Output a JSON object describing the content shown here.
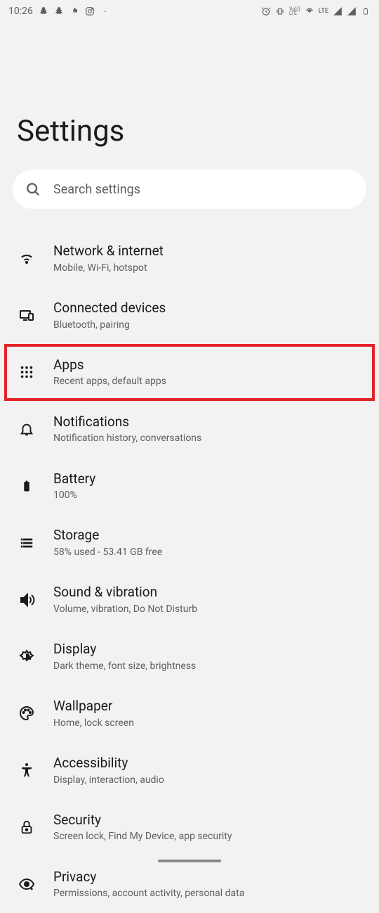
{
  "statusBar": {
    "time": "10:26",
    "lte": "LTE"
  },
  "pageTitle": "Settings",
  "search": {
    "placeholder": "Search settings"
  },
  "items": [
    {
      "title": "Network & internet",
      "subtitle": "Mobile, Wi-Fi, hotspot"
    },
    {
      "title": "Connected devices",
      "subtitle": "Bluetooth, pairing"
    },
    {
      "title": "Apps",
      "subtitle": "Recent apps, default apps"
    },
    {
      "title": "Notifications",
      "subtitle": "Notification history, conversations"
    },
    {
      "title": "Battery",
      "subtitle": "100%"
    },
    {
      "title": "Storage",
      "subtitle": "58% used - 53.41 GB free"
    },
    {
      "title": "Sound & vibration",
      "subtitle": "Volume, vibration, Do Not Disturb"
    },
    {
      "title": "Display",
      "subtitle": "Dark theme, font size, brightness"
    },
    {
      "title": "Wallpaper",
      "subtitle": "Home, lock screen"
    },
    {
      "title": "Accessibility",
      "subtitle": "Display, interaction, audio"
    },
    {
      "title": "Security",
      "subtitle": "Screen lock, Find My Device, app security"
    },
    {
      "title": "Privacy",
      "subtitle": "Permissions, account activity, personal data"
    }
  ]
}
